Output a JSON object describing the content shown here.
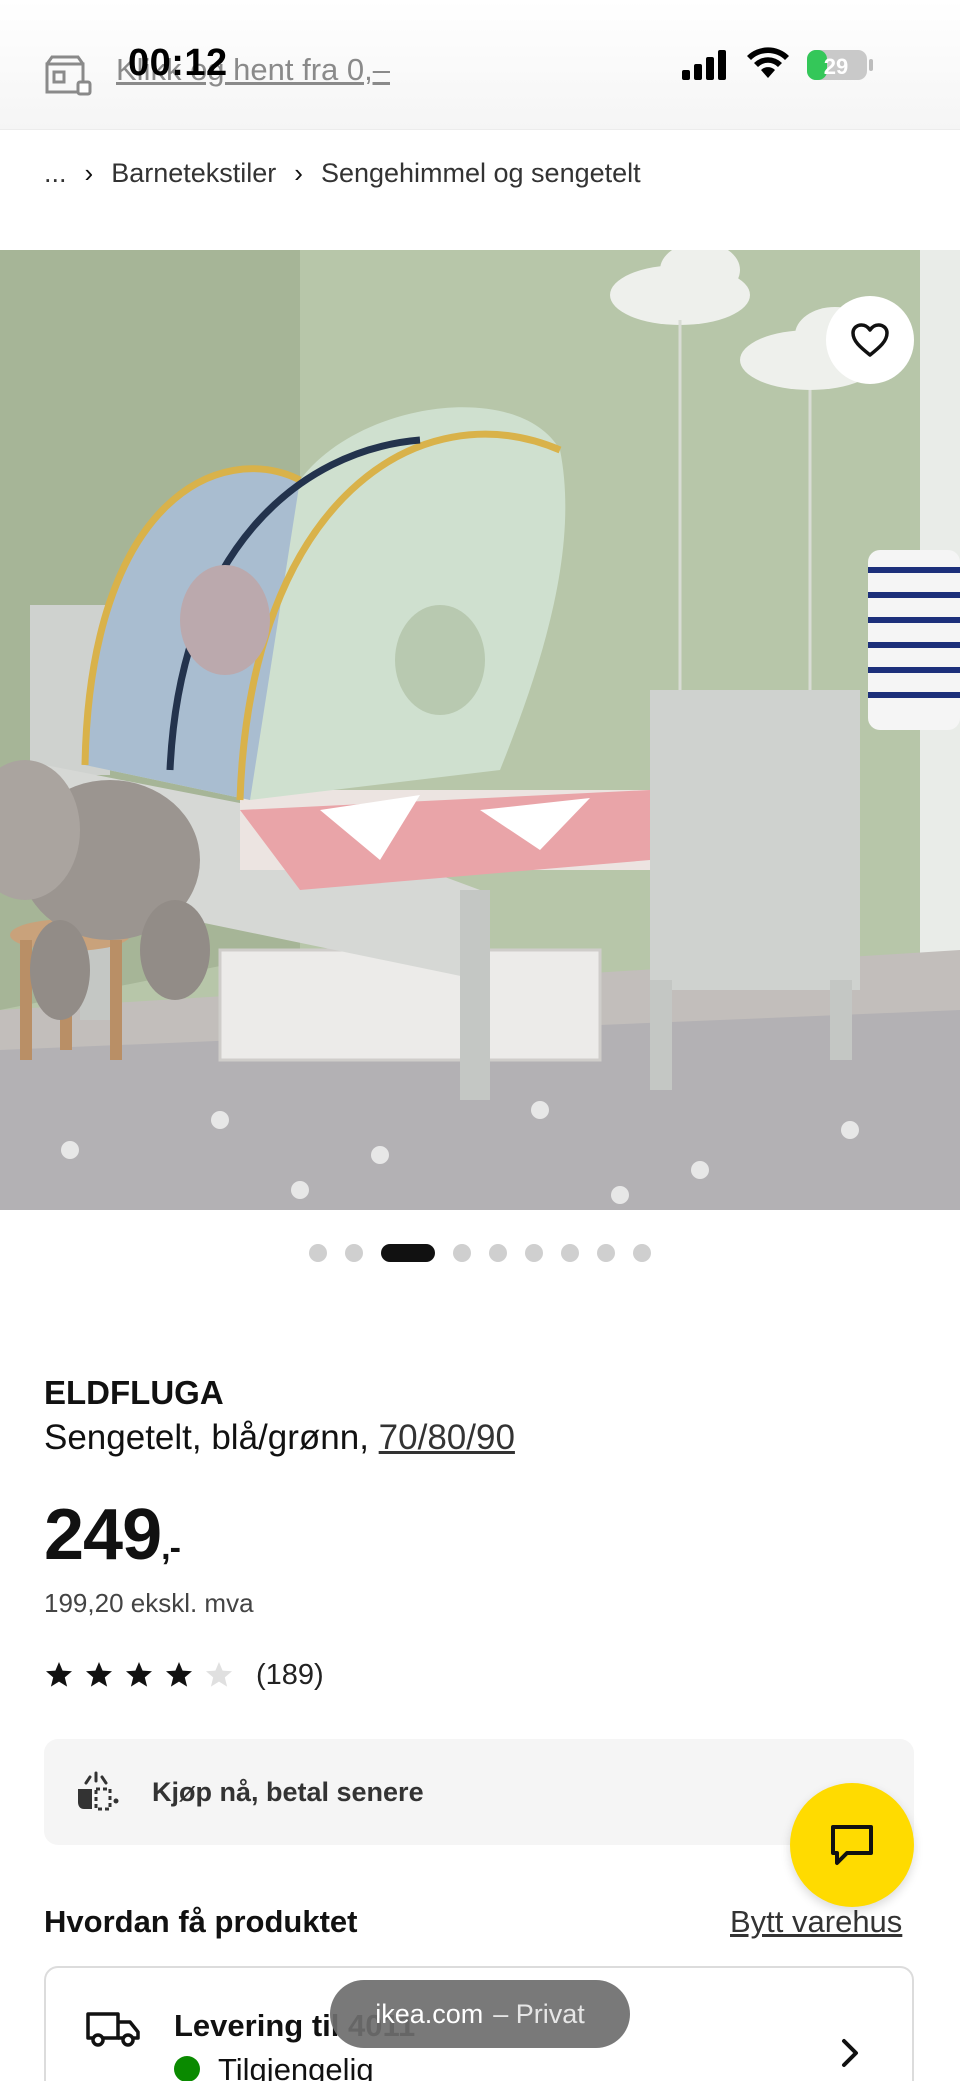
{
  "status_bar": {
    "time": "00:12",
    "battery": "29"
  },
  "top": {
    "store_link": "Klikk og hent fra 0,–"
  },
  "breadcrumb": {
    "ellipsis": "...",
    "items": [
      "Barnetekstiler",
      "Sengehimmel og sengetelt"
    ]
  },
  "gallery": {
    "total_dots": 9,
    "active_index": 2
  },
  "product": {
    "name": "ELDFLUGA",
    "description": "Sengetelt, blå/grønn,",
    "size_link": "70/80/90",
    "price_main": "249",
    "price_suffix": ",-",
    "price_ex_vat": "199,20 ekskl. mva",
    "rating": 4,
    "rating_max": 5,
    "review_count": "(189)"
  },
  "pay_later": {
    "label": "Kjøp nå, betal senere"
  },
  "how_to": {
    "title": "Hvordan få produktet",
    "change_store": "Bytt varehus"
  },
  "delivery": {
    "title": "Levering til 4011",
    "availability": "Tilgjengelig"
  },
  "browser": {
    "domain": "ikea.com",
    "mode": "– Privat"
  },
  "colors": {
    "accent_yellow": "#ffdb00",
    "available_green": "#0a8a00"
  }
}
